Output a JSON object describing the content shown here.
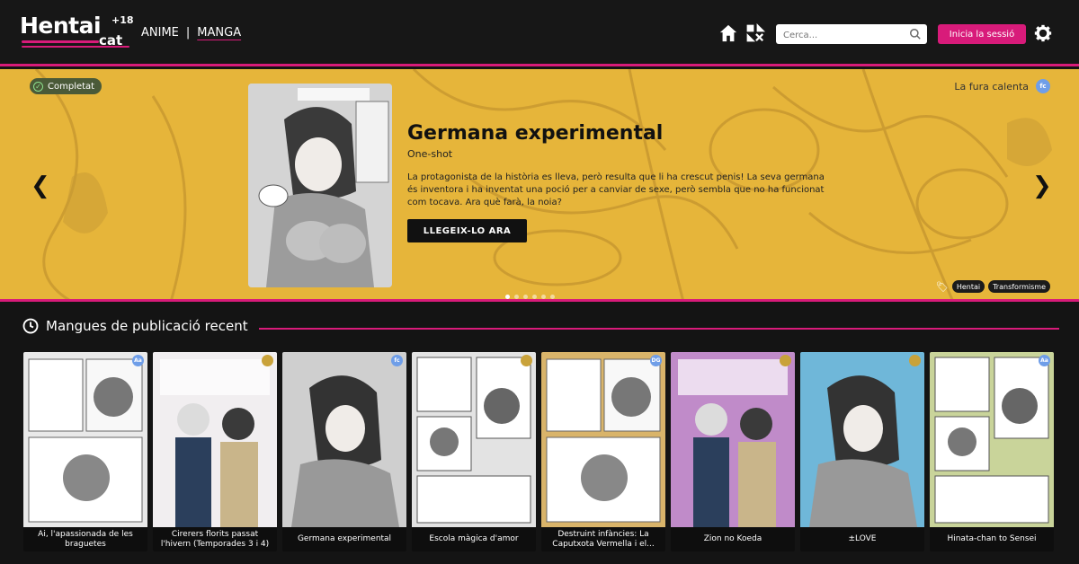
{
  "header": {
    "logo_text": "Hentai",
    "logo_sub": "cat",
    "logo_mark": "+18",
    "nav": {
      "anime": "ANIME",
      "separator": "|",
      "manga": "MANGA"
    },
    "search_placeholder": "Cerca...",
    "login_label": "Inicia la sessió",
    "icons": [
      "home-icon",
      "random-icon",
      "search-icon",
      "gear-icon"
    ]
  },
  "hero": {
    "status": "Completat",
    "fansub": "La fura calenta",
    "fansub_badge": "fc",
    "title": "Germana experimental",
    "type": "One-shot",
    "description": "La protagonista de la història es lleva, però resulta que li ha crescut penis! La seva germana és inventora i ha inventat una poció per a canviar de sexe, però sembla que no ha funcionat com tocava. Ara què farà, la noia?",
    "read_label": "LLEGEIX-LO ARA",
    "tags": [
      "Hentai",
      "Transformisme"
    ],
    "slides": 6,
    "active_slide": 0
  },
  "recent": {
    "title": "Mangues de publicació recent",
    "items": [
      {
        "title": "Ai, l'apassionada de les braguetes",
        "badge": "Aa",
        "badge_color": "#6f9ee8",
        "bg": "#e9e9e9"
      },
      {
        "title": "Cirerers florits passat l'hivern (Temporades 3 i 4)",
        "badge": "",
        "badge_color": "#c9a23a",
        "bg": "#f1eef0"
      },
      {
        "title": "Germana experimental",
        "badge": "fc",
        "badge_color": "#6f9ee8",
        "bg": "#cfcfcf"
      },
      {
        "title": "Escola màgica d'amor",
        "badge": "",
        "badge_color": "#c9a23a",
        "bg": "#e3e3e3"
      },
      {
        "title": "Destruint infàncies: La Caputxota Vermella i el...",
        "badge": "DG",
        "badge_color": "#6f9ee8",
        "bg": "#d9b46a"
      },
      {
        "title": "Zion no Koeda",
        "badge": "",
        "badge_color": "#c9a23a",
        "bg": "#c08bc9"
      },
      {
        "title": "±LOVE",
        "badge": "",
        "badge_color": "#c9a23a",
        "bg": "#6fb7d9"
      },
      {
        "title": "Hinata-chan to Sensei",
        "badge": "Aa",
        "badge_color": "#6f9ee8",
        "bg": "#c9d49a"
      }
    ]
  },
  "colors": {
    "accent": "#d81b7a",
    "hero_bg": "#e6b53a",
    "page_bg": "#141414"
  }
}
